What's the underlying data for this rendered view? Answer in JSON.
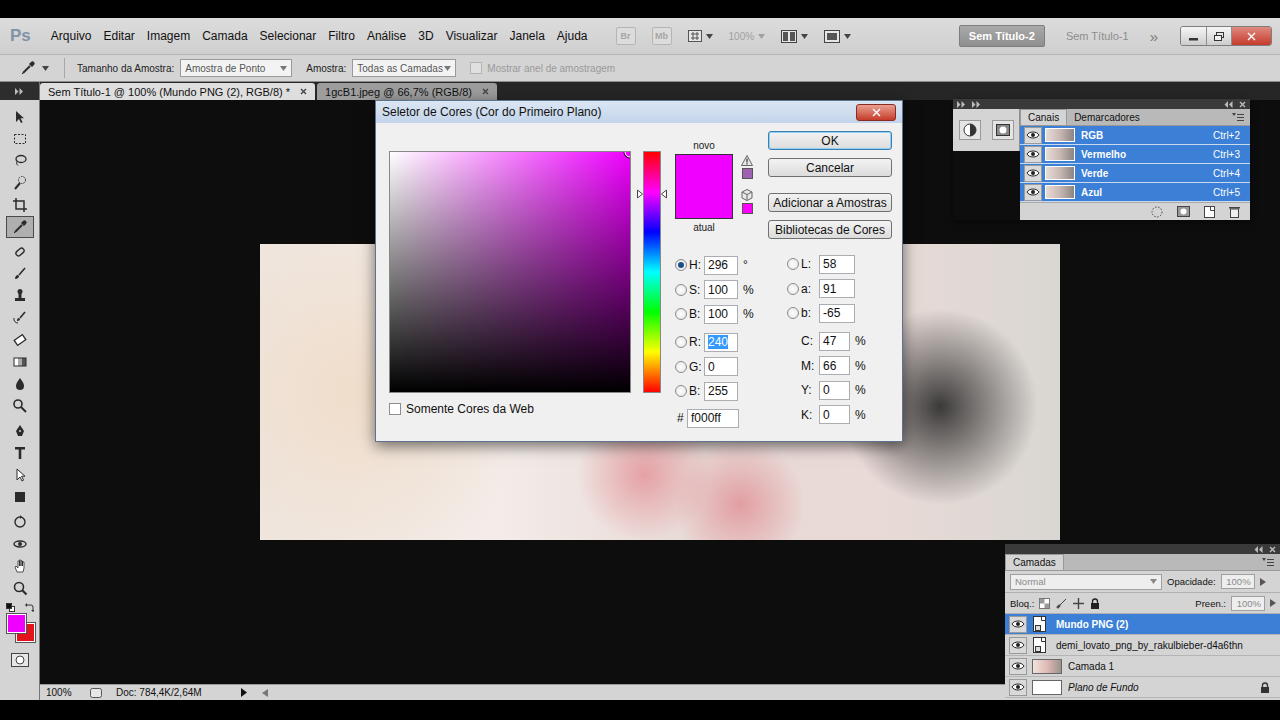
{
  "app": {
    "logo": "Ps"
  },
  "menu": [
    "Arquivo",
    "Editar",
    "Imagem",
    "Camada",
    "Selecionar",
    "Filtro",
    "Análise",
    "3D",
    "Visualizar",
    "Janela",
    "Ajuda"
  ],
  "app_bar": {
    "bridge": "Br",
    "mini_bridge": "Mb",
    "zoom": "100%",
    "zoom_disabled": true,
    "documents": [
      {
        "label": "Sem Título-2",
        "selected": true
      },
      {
        "label": "Sem Título-1",
        "selected": false
      }
    ],
    "more": "»"
  },
  "options_bar": {
    "sample_size_label": "Tamanho da Amostra:",
    "sample_size": "Amostra de Ponto",
    "sample_label": "Amostra:",
    "sample": "Todas as Camadas",
    "ring_label": "Mostrar anel de amostragem",
    "ring_checked": false,
    "ring_disabled": true
  },
  "doc_tabs": [
    {
      "label": "Sem Título-1 @ 100% (Mundo PNG (2), RGB/8) *",
      "selected": true
    },
    {
      "label": "1gcB1.jpeg @ 66,7% (RGB/8)",
      "selected": false
    }
  ],
  "toolbox": {
    "tools": [
      {
        "kind": "move",
        "selected": false
      },
      {
        "kind": "marquee",
        "selected": false
      },
      {
        "kind": "lasso",
        "selected": false
      },
      {
        "kind": "quick-select",
        "selected": false
      },
      {
        "kind": "crop",
        "selected": false
      },
      {
        "kind": "eyedropper",
        "selected": true
      },
      {
        "kind": "healing",
        "selected": false
      },
      {
        "kind": "brush",
        "selected": false
      },
      {
        "kind": "stamp",
        "selected": false
      },
      {
        "kind": "history",
        "selected": false
      },
      {
        "kind": "eraser",
        "selected": false
      },
      {
        "kind": "gradient",
        "selected": false
      },
      {
        "kind": "blur",
        "selected": false
      },
      {
        "kind": "dodge",
        "selected": false
      },
      {
        "kind": "pen",
        "selected": false
      },
      {
        "kind": "type",
        "selected": false
      },
      {
        "kind": "path-select",
        "selected": false
      },
      {
        "kind": "shape",
        "selected": false
      },
      {
        "kind": "rotate-3d",
        "selected": false
      },
      {
        "kind": "orbit-3d",
        "selected": false
      },
      {
        "kind": "hand",
        "selected": false
      },
      {
        "kind": "zoom",
        "selected": false
      }
    ],
    "foreground": "#f000ff",
    "background": "#e3141c"
  },
  "color_picker": {
    "title": "Seletor de Cores (Cor do Primeiro Plano)",
    "new_label": "novo",
    "current_label": "atual",
    "new_color": "#f000ff",
    "current_color": "#f000ff",
    "hue_level": 0.822,
    "field_marker": {
      "x": 1,
      "y": 0
    },
    "warnings": [
      {
        "kind": "gamut",
        "color": "#9f62b3"
      },
      {
        "kind": "web",
        "color": "#ff00ff"
      }
    ],
    "buttons": [
      {
        "label": "OK",
        "default": true
      },
      {
        "label": "Cancelar",
        "default": false
      },
      {
        "label": "Adicionar a Amostras",
        "default": false
      },
      {
        "label": "Bibliotecas de Cores",
        "default": false
      }
    ],
    "hsb": [
      {
        "label": "H:",
        "value": "296",
        "unit": "°",
        "selected": true,
        "focused": false
      },
      {
        "label": "S:",
        "value": "100",
        "unit": "%",
        "selected": false,
        "focused": false
      },
      {
        "label": "B:",
        "value": "100",
        "unit": "%",
        "selected": false,
        "focused": false
      }
    ],
    "rgb": [
      {
        "label": "R:",
        "value": "240",
        "unit": "",
        "selected": false,
        "focused": true
      },
      {
        "label": "G:",
        "value": "0",
        "unit": "",
        "selected": false,
        "focused": false
      },
      {
        "label": "B:",
        "value": "255",
        "unit": "",
        "selected": false,
        "focused": false
      }
    ],
    "hex": {
      "label": "#",
      "value": "f000ff"
    },
    "lab": [
      {
        "label": "L:",
        "value": "58",
        "unit": "",
        "selected": false,
        "focused": false
      },
      {
        "label": "a:",
        "value": "91",
        "unit": "",
        "selected": false,
        "focused": false
      },
      {
        "label": "b:",
        "value": "-65",
        "unit": "",
        "selected": false,
        "focused": false
      }
    ],
    "cmyk": [
      {
        "label": "C:",
        "value": "47",
        "unit": "%"
      },
      {
        "label": "M:",
        "value": "66",
        "unit": "%"
      },
      {
        "label": "Y:",
        "value": "0",
        "unit": "%"
      },
      {
        "label": "K:",
        "value": "0",
        "unit": "%"
      }
    ],
    "web_only": {
      "label": "Somente Cores da Web",
      "checked": false
    }
  },
  "channels_panel": {
    "tabs": [
      {
        "label": "Canais",
        "selected": true
      },
      {
        "label": "Demarcadores",
        "selected": false
      }
    ],
    "channels": [
      {
        "name": "RGB",
        "shortcut": "Ctrl+2",
        "selected": true,
        "visible": true
      },
      {
        "name": "Vermelho",
        "shortcut": "Ctrl+3",
        "selected": true,
        "visible": true
      },
      {
        "name": "Verde",
        "shortcut": "Ctrl+4",
        "selected": true,
        "visible": true
      },
      {
        "name": "Azul",
        "shortcut": "Ctrl+5",
        "selected": true,
        "visible": true
      }
    ]
  },
  "layers_panel": {
    "tab": "Camadas",
    "blend_mode": "Normal",
    "opacity_label": "Opacidade:",
    "opacity": "100%",
    "lock_label": "Bloq.:",
    "fill_label": "Preen.:",
    "fill": "100%",
    "layers": [
      {
        "name": "Mundo PNG (2)",
        "kind": "smart",
        "selected": true,
        "visible": true,
        "locked": false
      },
      {
        "name": "demi_lovato_png_by_rakulbieber-d4a6thn",
        "kind": "smart",
        "selected": false,
        "visible": true,
        "locked": false
      },
      {
        "name": "Camada 1",
        "kind": "image",
        "selected": false,
        "visible": true,
        "locked": false
      },
      {
        "name": "Plano de Fundo",
        "kind": "background",
        "selected": false,
        "visible": true,
        "locked": true
      }
    ]
  },
  "status_bar": {
    "zoom": "100%",
    "doc": "Doc: 784,4K/2,64M"
  }
}
